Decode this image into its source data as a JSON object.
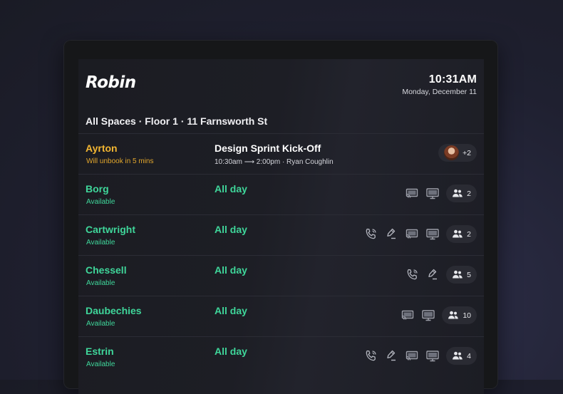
{
  "app": {
    "logo": "Robin"
  },
  "header": {
    "time": "10:31AM",
    "date": "Monday, December 11"
  },
  "location": "All Spaces · Floor 1 · 11 Farnsworth St",
  "rooms": [
    {
      "name": "Ayrton",
      "status": "Will unbook in 5 mins",
      "state": "warning",
      "booking_title": "Design Sprint Kick-Off",
      "booking_time": "10:30am ⟶ 2:00pm · Ryan Coughlin",
      "amenities": [],
      "attendees_label": "+2"
    },
    {
      "name": "Borg",
      "status": "Available",
      "state": "available",
      "booking_title": "All day",
      "booking_time": "",
      "amenities": [
        "cast-icon",
        "display-icon"
      ],
      "capacity": "2"
    },
    {
      "name": "Cartwright",
      "status": "Available",
      "state": "available",
      "booking_title": "All day",
      "booking_time": "",
      "amenities": [
        "phone-icon",
        "whiteboard-icon",
        "cast-icon",
        "display-icon"
      ],
      "capacity": "2"
    },
    {
      "name": "Chessell",
      "status": "Available",
      "state": "available",
      "booking_title": "All day",
      "booking_time": "",
      "amenities": [
        "phone-icon",
        "whiteboard-icon"
      ],
      "capacity": "5"
    },
    {
      "name": "Daubechies",
      "status": "Available",
      "state": "available",
      "booking_title": "All day",
      "booking_time": "",
      "amenities": [
        "cast-icon",
        "display-icon"
      ],
      "capacity": "10"
    },
    {
      "name": "Estrin",
      "status": "Available",
      "state": "available",
      "booking_title": "All day",
      "booking_time": "",
      "amenities": [
        "phone-icon",
        "whiteboard-icon",
        "cast-icon",
        "display-icon"
      ],
      "capacity": "4"
    }
  ],
  "colors": {
    "available": "#3fd69a",
    "warning": "#f3b632",
    "background": "#1b1c22"
  }
}
